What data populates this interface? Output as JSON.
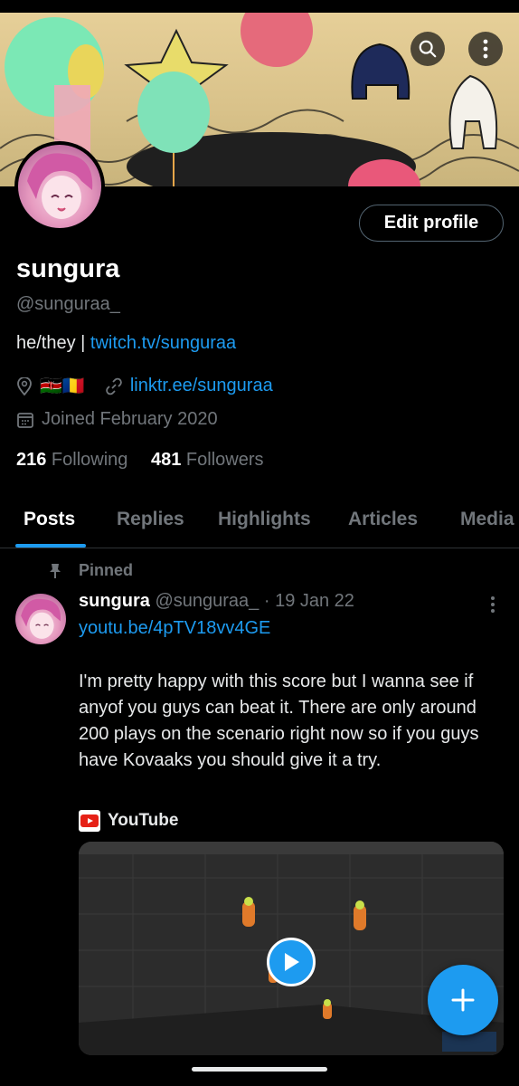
{
  "profile": {
    "display_name": "sungura",
    "handle": "@sunguraa_",
    "bio_prefix": "he/they | ",
    "bio_link": "twitch.tv/sunguraa",
    "location_flags": "🇰🇪🇷🇴",
    "website": "linktr.ee/sunguraa",
    "joined": "Joined February 2020",
    "following_count": "216",
    "following_label": " Following",
    "followers_count": "481",
    "followers_label": " Followers",
    "edit_label": "Edit profile"
  },
  "tabs": [
    "Posts",
    "Replies",
    "Highlights",
    "Articles",
    "Media"
  ],
  "pinned_post": {
    "pinned_label": "Pinned",
    "author": "sungura",
    "handle": "@sunguraa_",
    "date": " · 19 Jan 22",
    "link": "youtu.be/4pTV18vv4GE",
    "text": "I'm pretty happy with this score but I wanna see if anyof you guys can beat it. There are only around 200 plays on the scenario right now so if you guys have Kovaaks you should give it a try.",
    "card_source": "YouTube"
  },
  "icons": {
    "search": "search-icon",
    "more": "more-vertical-icon",
    "location": "location-pin-icon",
    "link": "link-icon",
    "calendar": "calendar-icon",
    "pin": "pin-icon",
    "youtube": "youtube-logo-icon",
    "play": "play-icon",
    "compose": "plus-icon"
  },
  "colors": {
    "accent": "#1d9bf0",
    "background": "#000000",
    "muted": "#71767b"
  }
}
